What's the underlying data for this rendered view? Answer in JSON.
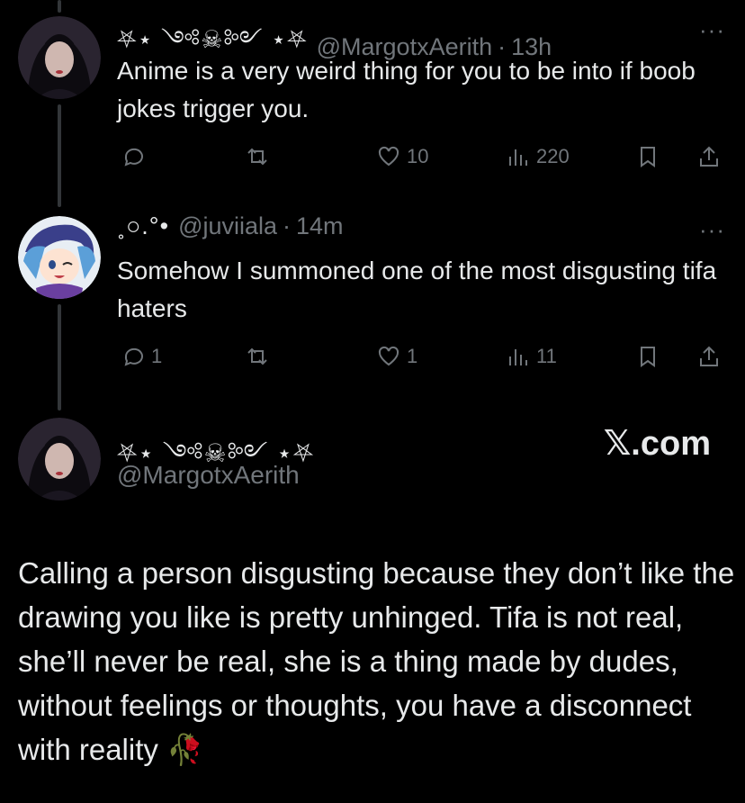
{
  "tweet1": {
    "display_name": "⛧⋆ ༺☠︎༻ ⋆⛧",
    "handle": "@MargotxAerith",
    "time": "13h",
    "more": "···",
    "text": "Anime is a very weird thing for you to be into if boob jokes trigger you.",
    "replies": "",
    "retweets": "",
    "likes": "10",
    "views": "220"
  },
  "tweet2": {
    "display_name": "˳○.°•",
    "handle": "@juviiala",
    "time": "14m",
    "more": "···",
    "text": "Somehow I summoned one of the most disgusting tifa haters",
    "replies": "1",
    "retweets": "",
    "likes": "1",
    "views": "11"
  },
  "post": {
    "display_name": "⛧⋆ ༺☠︎༻ ⋆⛧",
    "handle": "@MargotxAerith",
    "brand": "𝕏.com",
    "text": "Calling a person disgusting because they don’t like the drawing you like is pretty unhinged. Tifa is not real, she’ll never be real, she is a thing made by dudes, without feelings or thoughts, you have a disconnect with reality 🥀"
  },
  "separator": "·",
  "icons": [
    "reply-icon",
    "retweet-icon",
    "heart-icon",
    "views-icon",
    "bookmark-icon",
    "share-icon",
    "more-icon"
  ]
}
